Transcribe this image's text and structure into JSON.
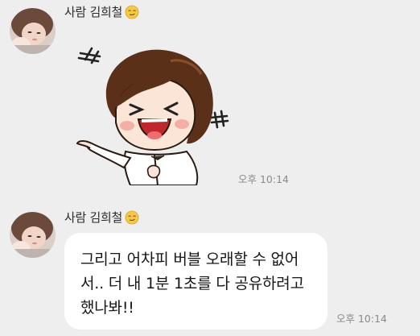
{
  "messages": [
    {
      "sender": "사람 김희철",
      "sender_emoji": "smirk-emoji",
      "type": "sticker",
      "sticker": "laughing-pointing-girl-sticker",
      "time": "오후 10:14"
    },
    {
      "sender": "사람 김희철",
      "sender_emoji": "smirk-emoji",
      "type": "text",
      "text": "그리고 어차피 버블 오래할 수 없어\n서.. 더 내 1분 1초를 다 공유하려고\n했나봐!!",
      "time": "오후 10:14"
    }
  ],
  "colors": {
    "background": "#eeeeee",
    "bubble": "#ffffff",
    "timestamp": "#8a8a8a"
  }
}
